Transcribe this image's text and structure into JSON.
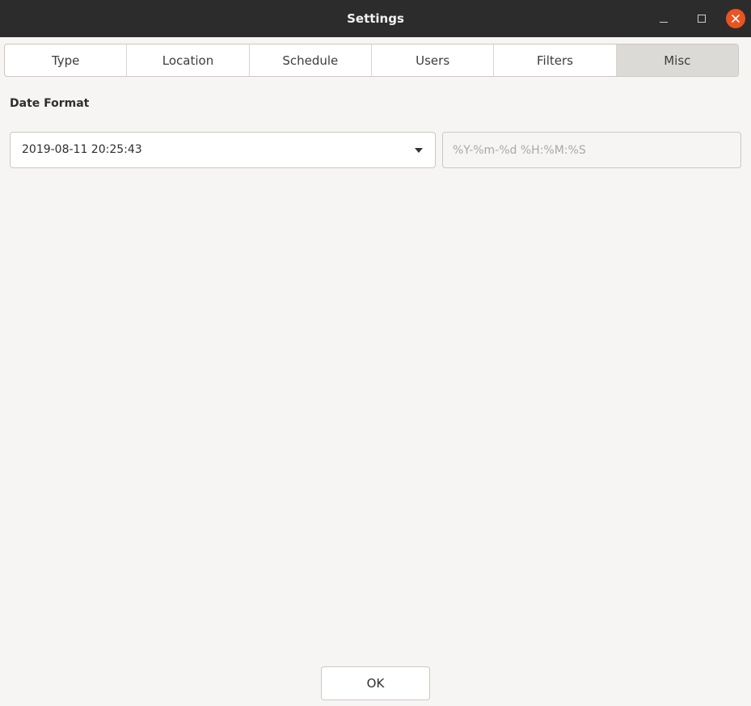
{
  "window": {
    "title": "Settings",
    "controls": {
      "minimize_icon": "minimize-icon",
      "maximize_icon": "maximize-icon",
      "close_icon": "close-icon",
      "close_color": "#e95420"
    }
  },
  "tabs": [
    {
      "label": "Type",
      "active": false
    },
    {
      "label": "Location",
      "active": false
    },
    {
      "label": "Schedule",
      "active": false
    },
    {
      "label": "Users",
      "active": false
    },
    {
      "label": "Filters",
      "active": false
    },
    {
      "label": "Misc",
      "active": true
    }
  ],
  "misc": {
    "date_format_label": "Date Format",
    "date_format_selected": "2019-08-11 20:25:43",
    "dropdown_icon": "chevron-down-icon",
    "custom_format_placeholder": "%Y-%m-%d %H:%M:%S",
    "custom_format_value": ""
  },
  "footer": {
    "ok_label": "OK"
  }
}
